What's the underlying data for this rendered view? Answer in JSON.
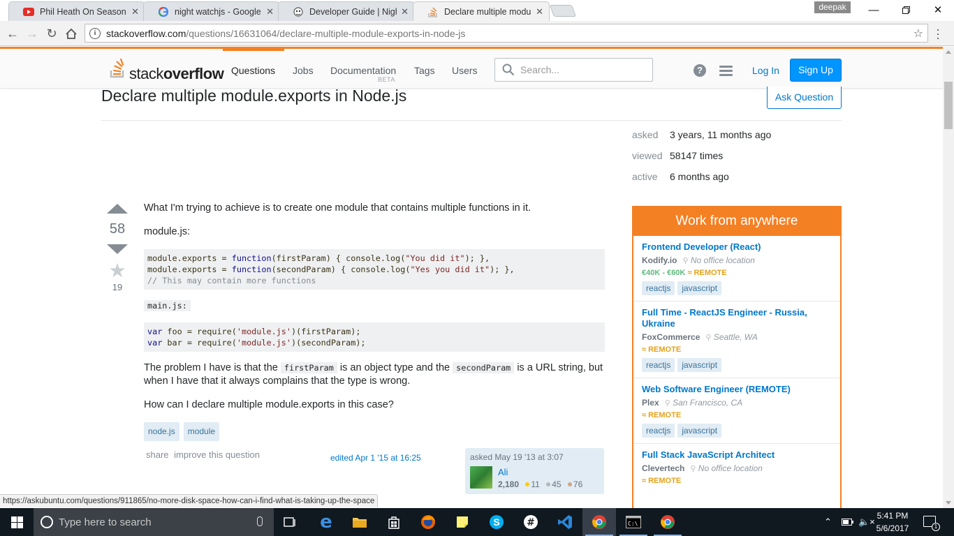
{
  "browser": {
    "tabs": [
      {
        "title": "Phil Heath On Season Vs",
        "icon": "youtube-icon",
        "active": false
      },
      {
        "title": "night watchjs - Google Se",
        "icon": "google-icon",
        "active": false
      },
      {
        "title": "Developer Guide | Nightw",
        "icon": "nightwatch-icon",
        "active": false
      },
      {
        "title": "Declare multiple module.",
        "icon": "stackoverflow-icon",
        "active": true
      }
    ],
    "user_badge": "deepak",
    "url_host": "stackoverflow.com",
    "url_path": "/questions/16631064/declare-multiple-module-exports-in-node-js",
    "status_url": "https://askubuntu.com/questions/911865/no-more-disk-space-how-can-i-find-what-is-taking-up-the-space"
  },
  "so_header": {
    "logo_light": "stack",
    "logo_bold": "overflow",
    "nav": [
      {
        "label": "Questions",
        "active": true
      },
      {
        "label": "Jobs",
        "active": false
      },
      {
        "label": "Documentation",
        "active": false
      },
      {
        "label": "Tags",
        "active": false
      },
      {
        "label": "Users",
        "active": false
      }
    ],
    "beta": "BETA",
    "search_placeholder": "Search...",
    "login": "Log In",
    "signup": "Sign Up"
  },
  "question": {
    "title": "Declare multiple module.exports in Node.js",
    "ask_button": "Ask Question",
    "votes": "58",
    "favorites": "19",
    "intro": "What I'm trying to achieve is to create one module that contains multiple functions in it.",
    "module_label": "module.js:",
    "main_label": "main.js:",
    "problem_a": "The problem I have is that the",
    "first_param": "firstParam",
    "problem_b": "is an object type and the",
    "second_param": "secondParam",
    "problem_c": "is a URL string, but when I have that it always complains that the type is wrong.",
    "ask_line": "How can I declare multiple module.exports in this case?",
    "tags": [
      "node.js",
      "module"
    ],
    "menu_share": "share",
    "menu_improve": "improve this question",
    "edited": "edited Apr 1 '15 at 16:25",
    "asked_line": "asked May 19 '13 at 3:07",
    "owner_name": "Ali",
    "owner_rep": "2,180",
    "owner_gold": "11",
    "owner_silver": "45",
    "owner_bronze": "76"
  },
  "stats": {
    "asked_label": "asked",
    "asked_value": "3 years, 11 months ago",
    "viewed_label": "viewed",
    "viewed_value": "58147 times",
    "active_label": "active",
    "active_value": "6 months ago"
  },
  "jobs": {
    "header": "Work from anywhere",
    "items": [
      {
        "title": "Frontend Developer (React)",
        "company": "Kodify.io",
        "location": "No office location",
        "salary": "€40K - €60K",
        "remote": "REMOTE",
        "tags": [
          "reactjs",
          "javascript"
        ]
      },
      {
        "title": "Full Time - ReactJS Engineer - Russia, Ukraine",
        "company": "FoxCommerce",
        "location": "Seattle, WA",
        "salary": "",
        "remote": "REMOTE",
        "tags": [
          "reactjs",
          "javascript"
        ]
      },
      {
        "title": "Web Software Engineer (REMOTE)",
        "company": "Plex",
        "location": "San Francisco, CA",
        "salary": "",
        "remote": "REMOTE",
        "tags": [
          "reactjs",
          "javascript"
        ]
      },
      {
        "title": "Full Stack JavaScript Architect",
        "company": "Clevertech",
        "location": "No office location",
        "salary": "",
        "remote": "REMOTE",
        "tags": []
      }
    ]
  },
  "taskbar": {
    "search_placeholder": "Type here to search",
    "time": "5:41 PM",
    "date": "5/6/2017",
    "notification_count": "1"
  },
  "colors": {
    "so_orange": "#f48024",
    "link_blue": "#0077cc",
    "tag_bg": "#e1ecf4",
    "taskbar": "#101820"
  }
}
